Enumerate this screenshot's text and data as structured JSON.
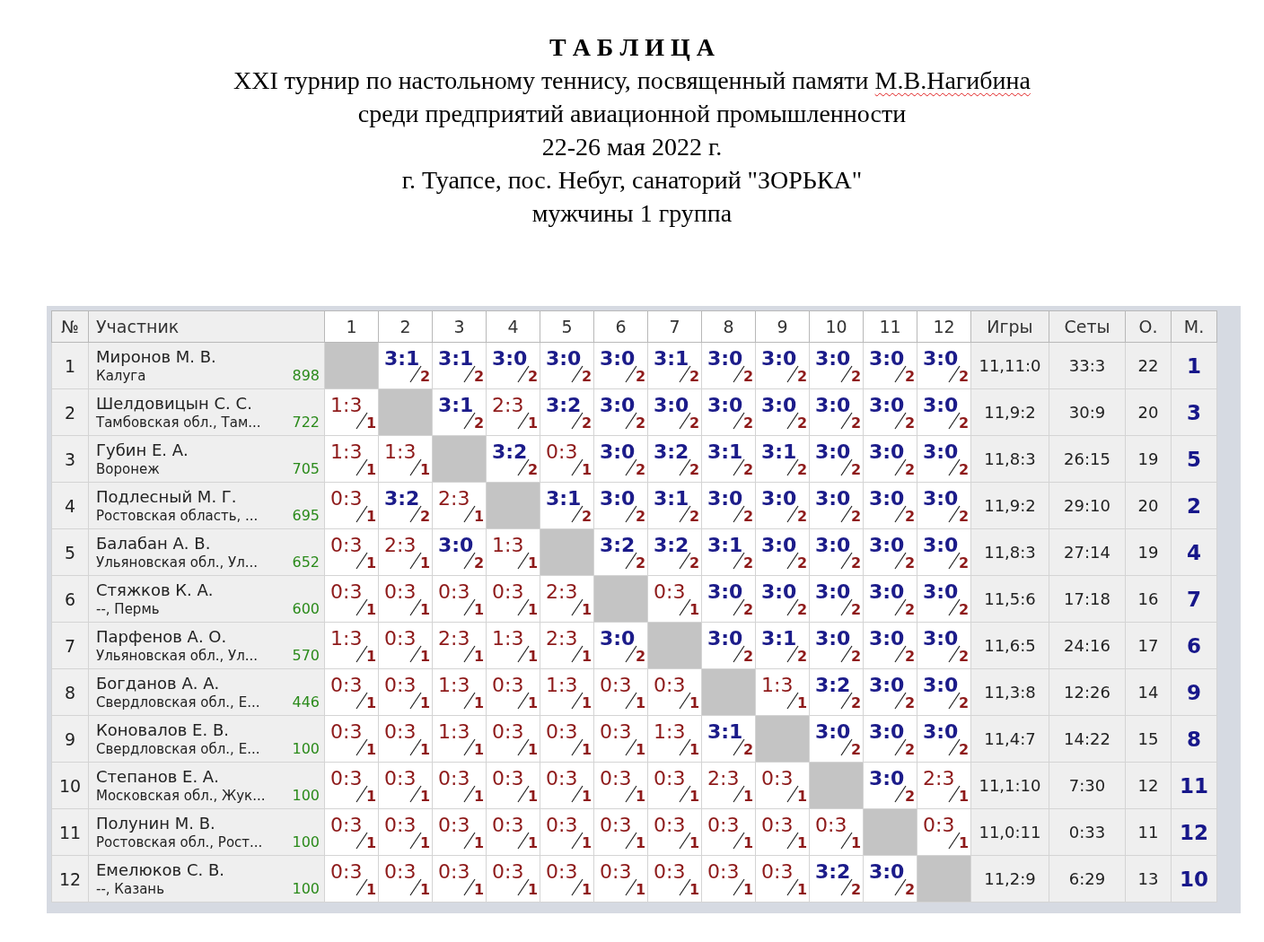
{
  "document": {
    "heading": "Т А Б Л И Ц А",
    "lines": [
      {
        "text": "XXI турнир по настольному теннису, посвященный памяти ",
        "misspelled": "М.В.Нагибина"
      },
      {
        "text": "среди предприятий авиационной промышленности"
      },
      {
        "text": "22-26 мая 2022 г."
      },
      {
        "text": "г. Туапсе, пос. Небуг, санаторий \"ЗОРЬКА\""
      },
      {
        "text": "мужчины 1 группа"
      }
    ]
  },
  "table": {
    "columns": {
      "number": "№",
      "participant": "Участник",
      "opponents": [
        "1",
        "2",
        "3",
        "4",
        "5",
        "6",
        "7",
        "8",
        "9",
        "10",
        "11",
        "12"
      ],
      "games": "Игры",
      "sets": "Сеты",
      "points": "О.",
      "place": "М."
    },
    "rows": [
      {
        "number": "1",
        "name": "Миронов М. В.",
        "region": "Калуга",
        "rating": "898",
        "cells": [
          {
            "kind": "self"
          },
          {
            "score": "3:1",
            "points": "2",
            "won": true
          },
          {
            "score": "3:1",
            "points": "2",
            "won": true
          },
          {
            "score": "3:0",
            "points": "2",
            "won": true
          },
          {
            "score": "3:0",
            "points": "2",
            "won": true
          },
          {
            "score": "3:0",
            "points": "2",
            "won": true
          },
          {
            "score": "3:1",
            "points": "2",
            "won": true
          },
          {
            "score": "3:0",
            "points": "2",
            "won": true
          },
          {
            "score": "3:0",
            "points": "2",
            "won": true
          },
          {
            "score": "3:0",
            "points": "2",
            "won": true
          },
          {
            "score": "3:0",
            "points": "2",
            "won": true
          },
          {
            "score": "3:0",
            "points": "2",
            "won": true
          }
        ],
        "games": "11,11:0",
        "sets": "33:3",
        "points": "22",
        "place": "1"
      },
      {
        "number": "2",
        "name": "Шелдовицын С. С.",
        "region": "Тамбовская обл., Там...",
        "rating": "722",
        "cells": [
          {
            "score": "1:3",
            "points": "1",
            "won": false
          },
          {
            "kind": "self"
          },
          {
            "score": "3:1",
            "points": "2",
            "won": true
          },
          {
            "score": "2:3",
            "points": "1",
            "won": false
          },
          {
            "score": "3:2",
            "points": "2",
            "won": true
          },
          {
            "score": "3:0",
            "points": "2",
            "won": true
          },
          {
            "score": "3:0",
            "points": "2",
            "won": true
          },
          {
            "score": "3:0",
            "points": "2",
            "won": true
          },
          {
            "score": "3:0",
            "points": "2",
            "won": true
          },
          {
            "score": "3:0",
            "points": "2",
            "won": true
          },
          {
            "score": "3:0",
            "points": "2",
            "won": true
          },
          {
            "score": "3:0",
            "points": "2",
            "won": true
          }
        ],
        "games": "11,9:2",
        "sets": "30:9",
        "points": "20",
        "place": "3"
      },
      {
        "number": "3",
        "name": "Губин Е. А.",
        "region": "Воронеж",
        "rating": "705",
        "cells": [
          {
            "score": "1:3",
            "points": "1",
            "won": false
          },
          {
            "score": "1:3",
            "points": "1",
            "won": false
          },
          {
            "kind": "self"
          },
          {
            "score": "3:2",
            "points": "2",
            "won": true
          },
          {
            "score": "0:3",
            "points": "1",
            "won": false
          },
          {
            "score": "3:0",
            "points": "2",
            "won": true
          },
          {
            "score": "3:2",
            "points": "2",
            "won": true
          },
          {
            "score": "3:1",
            "points": "2",
            "won": true
          },
          {
            "score": "3:1",
            "points": "2",
            "won": true
          },
          {
            "score": "3:0",
            "points": "2",
            "won": true
          },
          {
            "score": "3:0",
            "points": "2",
            "won": true
          },
          {
            "score": "3:0",
            "points": "2",
            "won": true
          }
        ],
        "games": "11,8:3",
        "sets": "26:15",
        "points": "19",
        "place": "5"
      },
      {
        "number": "4",
        "name": "Подлесный М. Г.",
        "region": "Ростовская область, ...",
        "rating": "695",
        "cells": [
          {
            "score": "0:3",
            "points": "1",
            "won": false
          },
          {
            "score": "3:2",
            "points": "2",
            "won": true
          },
          {
            "score": "2:3",
            "points": "1",
            "won": false
          },
          {
            "kind": "self"
          },
          {
            "score": "3:1",
            "points": "2",
            "won": true
          },
          {
            "score": "3:0",
            "points": "2",
            "won": true
          },
          {
            "score": "3:1",
            "points": "2",
            "won": true
          },
          {
            "score": "3:0",
            "points": "2",
            "won": true
          },
          {
            "score": "3:0",
            "points": "2",
            "won": true
          },
          {
            "score": "3:0",
            "points": "2",
            "won": true
          },
          {
            "score": "3:0",
            "points": "2",
            "won": true
          },
          {
            "score": "3:0",
            "points": "2",
            "won": true
          }
        ],
        "games": "11,9:2",
        "sets": "29:10",
        "points": "20",
        "place": "2"
      },
      {
        "number": "5",
        "name": "Балабан А. В.",
        "region": "Ульяновская обл., Ул...",
        "rating": "652",
        "cells": [
          {
            "score": "0:3",
            "points": "1",
            "won": false
          },
          {
            "score": "2:3",
            "points": "1",
            "won": false
          },
          {
            "score": "3:0",
            "points": "2",
            "won": true
          },
          {
            "score": "1:3",
            "points": "1",
            "won": false
          },
          {
            "kind": "self"
          },
          {
            "score": "3:2",
            "points": "2",
            "won": true
          },
          {
            "score": "3:2",
            "points": "2",
            "won": true
          },
          {
            "score": "3:1",
            "points": "2",
            "won": true
          },
          {
            "score": "3:0",
            "points": "2",
            "won": true
          },
          {
            "score": "3:0",
            "points": "2",
            "won": true
          },
          {
            "score": "3:0",
            "points": "2",
            "won": true
          },
          {
            "score": "3:0",
            "points": "2",
            "won": true
          }
        ],
        "games": "11,8:3",
        "sets": "27:14",
        "points": "19",
        "place": "4"
      },
      {
        "number": "6",
        "name": "Стяжков К. А.",
        "region": "--, Пермь",
        "rating": "600",
        "cells": [
          {
            "score": "0:3",
            "points": "1",
            "won": false
          },
          {
            "score": "0:3",
            "points": "1",
            "won": false
          },
          {
            "score": "0:3",
            "points": "1",
            "won": false
          },
          {
            "score": "0:3",
            "points": "1",
            "won": false
          },
          {
            "score": "2:3",
            "points": "1",
            "won": false
          },
          {
            "kind": "self"
          },
          {
            "score": "0:3",
            "points": "1",
            "won": false
          },
          {
            "score": "3:0",
            "points": "2",
            "won": true
          },
          {
            "score": "3:0",
            "points": "2",
            "won": true
          },
          {
            "score": "3:0",
            "points": "2",
            "won": true
          },
          {
            "score": "3:0",
            "points": "2",
            "won": true
          },
          {
            "score": "3:0",
            "points": "2",
            "won": true
          }
        ],
        "games": "11,5:6",
        "sets": "17:18",
        "points": "16",
        "place": "7"
      },
      {
        "number": "7",
        "name": "Парфенов А. О.",
        "region": "Ульяновская обл., Ул...",
        "rating": "570",
        "cells": [
          {
            "score": "1:3",
            "points": "1",
            "won": false
          },
          {
            "score": "0:3",
            "points": "1",
            "won": false
          },
          {
            "score": "2:3",
            "points": "1",
            "won": false
          },
          {
            "score": "1:3",
            "points": "1",
            "won": false
          },
          {
            "score": "2:3",
            "points": "1",
            "won": false
          },
          {
            "score": "3:0",
            "points": "2",
            "won": true
          },
          {
            "kind": "self"
          },
          {
            "score": "3:0",
            "points": "2",
            "won": true
          },
          {
            "score": "3:1",
            "points": "2",
            "won": true
          },
          {
            "score": "3:0",
            "points": "2",
            "won": true
          },
          {
            "score": "3:0",
            "points": "2",
            "won": true
          },
          {
            "score": "3:0",
            "points": "2",
            "won": true
          }
        ],
        "games": "11,6:5",
        "sets": "24:16",
        "points": "17",
        "place": "6"
      },
      {
        "number": "8",
        "name": "Богданов А. А.",
        "region": "Свердловская обл., Е...",
        "rating": "446",
        "cells": [
          {
            "score": "0:3",
            "points": "1",
            "won": false
          },
          {
            "score": "0:3",
            "points": "1",
            "won": false
          },
          {
            "score": "1:3",
            "points": "1",
            "won": false
          },
          {
            "score": "0:3",
            "points": "1",
            "won": false
          },
          {
            "score": "1:3",
            "points": "1",
            "won": false
          },
          {
            "score": "0:3",
            "points": "1",
            "won": false
          },
          {
            "score": "0:3",
            "points": "1",
            "won": false
          },
          {
            "kind": "self"
          },
          {
            "score": "1:3",
            "points": "1",
            "won": false
          },
          {
            "score": "3:2",
            "points": "2",
            "won": true
          },
          {
            "score": "3:0",
            "points": "2",
            "won": true
          },
          {
            "score": "3:0",
            "points": "2",
            "won": true
          }
        ],
        "games": "11,3:8",
        "sets": "12:26",
        "points": "14",
        "place": "9"
      },
      {
        "number": "9",
        "name": "Коновалов Е. В.",
        "region": "Свердловская обл., Е...",
        "rating": "100",
        "cells": [
          {
            "score": "0:3",
            "points": "1",
            "won": false
          },
          {
            "score": "0:3",
            "points": "1",
            "won": false
          },
          {
            "score": "1:3",
            "points": "1",
            "won": false
          },
          {
            "score": "0:3",
            "points": "1",
            "won": false
          },
          {
            "score": "0:3",
            "points": "1",
            "won": false
          },
          {
            "score": "0:3",
            "points": "1",
            "won": false
          },
          {
            "score": "1:3",
            "points": "1",
            "won": false
          },
          {
            "score": "3:1",
            "points": "2",
            "won": true
          },
          {
            "kind": "self"
          },
          {
            "score": "3:0",
            "points": "2",
            "won": true
          },
          {
            "score": "3:0",
            "points": "2",
            "won": true
          },
          {
            "score": "3:0",
            "points": "2",
            "won": true
          }
        ],
        "games": "11,4:7",
        "sets": "14:22",
        "points": "15",
        "place": "8"
      },
      {
        "number": "10",
        "name": "Степанов Е. А.",
        "region": "Московская обл., Жук...",
        "rating": "100",
        "cells": [
          {
            "score": "0:3",
            "points": "1",
            "won": false
          },
          {
            "score": "0:3",
            "points": "1",
            "won": false
          },
          {
            "score": "0:3",
            "points": "1",
            "won": false
          },
          {
            "score": "0:3",
            "points": "1",
            "won": false
          },
          {
            "score": "0:3",
            "points": "1",
            "won": false
          },
          {
            "score": "0:3",
            "points": "1",
            "won": false
          },
          {
            "score": "0:3",
            "points": "1",
            "won": false
          },
          {
            "score": "2:3",
            "points": "1",
            "won": false
          },
          {
            "score": "0:3",
            "points": "1",
            "won": false
          },
          {
            "kind": "self"
          },
          {
            "score": "3:0",
            "points": "2",
            "won": true
          },
          {
            "score": "2:3",
            "points": "1",
            "won": false
          }
        ],
        "games": "11,1:10",
        "sets": "7:30",
        "points": "12",
        "place": "11"
      },
      {
        "number": "11",
        "name": "Полунин М. В.",
        "region": "Ростовская обл., Рост...",
        "rating": "100",
        "cells": [
          {
            "score": "0:3",
            "points": "1",
            "won": false
          },
          {
            "score": "0:3",
            "points": "1",
            "won": false
          },
          {
            "score": "0:3",
            "points": "1",
            "won": false
          },
          {
            "score": "0:3",
            "points": "1",
            "won": false
          },
          {
            "score": "0:3",
            "points": "1",
            "won": false
          },
          {
            "score": "0:3",
            "points": "1",
            "won": false
          },
          {
            "score": "0:3",
            "points": "1",
            "won": false
          },
          {
            "score": "0:3",
            "points": "1",
            "won": false
          },
          {
            "score": "0:3",
            "points": "1",
            "won": false
          },
          {
            "score": "0:3",
            "points": "1",
            "won": false
          },
          {
            "kind": "self"
          },
          {
            "score": "0:3",
            "points": "1",
            "won": false
          }
        ],
        "games": "11,0:11",
        "sets": "0:33",
        "points": "11",
        "place": "12"
      },
      {
        "number": "12",
        "name": "Емелюков С. В.",
        "region": "--, Казань",
        "rating": "100",
        "cells": [
          {
            "score": "0:3",
            "points": "1",
            "won": false
          },
          {
            "score": "0:3",
            "points": "1",
            "won": false
          },
          {
            "score": "0:3",
            "points": "1",
            "won": false
          },
          {
            "score": "0:3",
            "points": "1",
            "won": false
          },
          {
            "score": "0:3",
            "points": "1",
            "won": false
          },
          {
            "score": "0:3",
            "points": "1",
            "won": false
          },
          {
            "score": "0:3",
            "points": "1",
            "won": false
          },
          {
            "score": "0:3",
            "points": "1",
            "won": false
          },
          {
            "score": "0:3",
            "points": "1",
            "won": false
          },
          {
            "score": "3:2",
            "points": "2",
            "won": true
          },
          {
            "score": "3:0",
            "points": "2",
            "won": true
          },
          {
            "kind": "self"
          }
        ],
        "games": "11,2:9",
        "sets": "6:29",
        "points": "13",
        "place": "10"
      }
    ]
  }
}
